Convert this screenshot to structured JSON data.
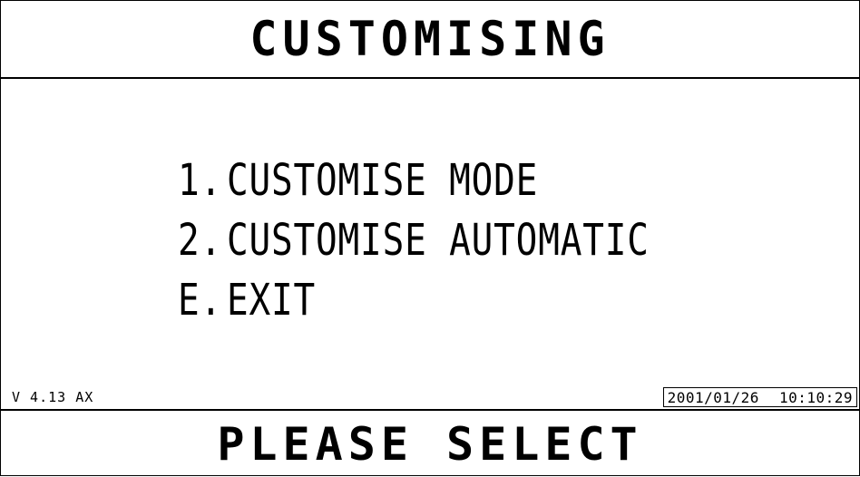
{
  "header": {
    "title": "CUSTOMISING"
  },
  "menu": {
    "items": [
      {
        "key": "1.",
        "label": "CUSTOMISE MODE"
      },
      {
        "key": "2.",
        "label": "CUSTOMISE AUTOMATIC"
      },
      {
        "key": "E.",
        "label": "EXIT"
      }
    ]
  },
  "status": {
    "version": "V 4.13 AX",
    "date": "2001/01/26",
    "time": "10:10:29"
  },
  "footer": {
    "prompt": "PLEASE SELECT"
  }
}
